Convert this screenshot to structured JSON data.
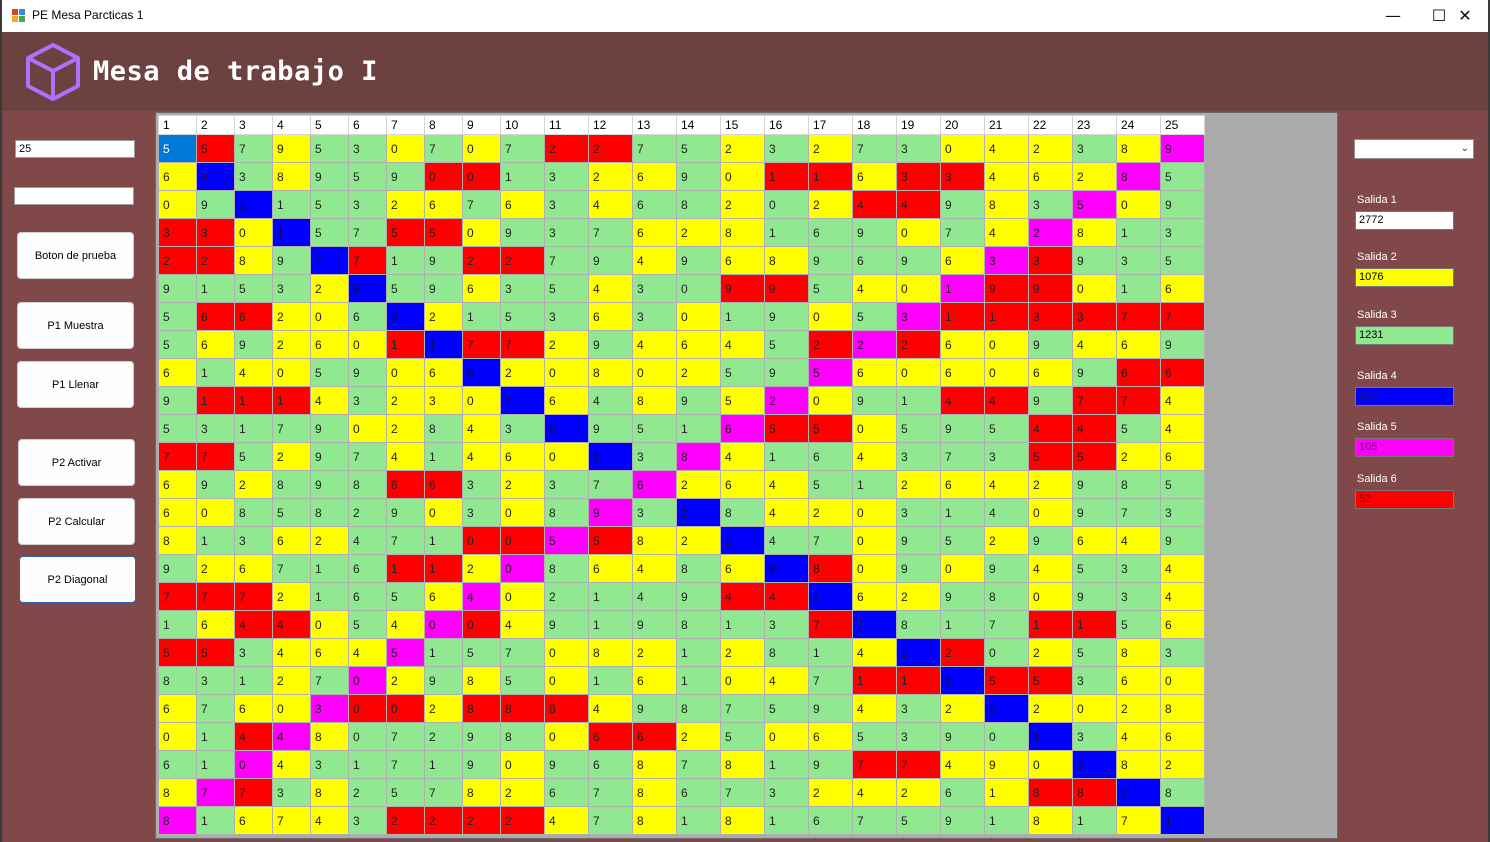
{
  "window": {
    "title": "PE Mesa Parcticas 1",
    "minimize": "—",
    "maximize": "☐",
    "close": "✕"
  },
  "header": {
    "title": "Mesa de trabajo I",
    "logo_icon": "cube-icon"
  },
  "left_panel": {
    "size_input": "25",
    "second_input": "",
    "buttons": {
      "test": "Boton de prueba",
      "p1_show": "P1 Muestra",
      "p1_fill": "P1 Llenar",
      "p2_activate": "P2 Activar",
      "p2_calc": "P2 Calcular",
      "p2_diag": "P2 Diagonal"
    }
  },
  "colors": {
    "G": "#90e890",
    "Y": "#ffff00",
    "R": "#ff0000",
    "B": "#0000ff",
    "M": "#ff00ff",
    "S": "#0078d7"
  },
  "grid": {
    "headers": [
      "1",
      "2",
      "3",
      "4",
      "5",
      "6",
      "7",
      "8",
      "9",
      "10",
      "11",
      "12",
      "13",
      "14",
      "15",
      "16",
      "17",
      "18",
      "19",
      "20",
      "21",
      "22",
      "23",
      "24",
      "25"
    ],
    "rows": [
      "5 5 7 9 5 3 0 7 0 7 2 2 7 5 2 3 2 7 3 0 4 2 3 8 9",
      "6 0 3 8 9 5 9 0 0 1 3 2 6 9 0 1 1 6 3 3 4 6 2 8 5",
      "0 9 2 1 5 3 2 6 7 6 3 4 6 8 2 0 2 4 4 9 8 3 5 0 9",
      "3 3 0 1 5 7 5 5 0 9 3 7 6 2 8 1 6 9 0 7 4 2 8 1 3",
      "2 2 8 9 7 7 1 9 2 2 7 9 4 9 6 8 9 6 9 6 3 3 9 3 5",
      "9 1 5 3 2 8 5 9 6 3 5 4 3 0 9 9 5 4 0 1 9 9 0 1 6",
      "5 6 6 2 0 6 9 2 1 5 3 6 3 0 1 9 0 5 3 1 1 3 3 7 7",
      "5 6 9 2 6 0 1 1 7 7 2 9 4 6 4 5 2 2 2 6 0 9 4 6 9",
      "6 1 4 0 5 9 0 6 6 2 0 8 0 2 5 9 5 6 0 6 0 6 9 6 6",
      "9 1 1 1 4 3 2 3 0 7 6 4 8 9 5 2 0 9 1 4 4 9 7 7 4",
      "5 3 1 7 9 0 2 8 4 3 8 9 5 1 6 5 5 0 5 9 5 4 4 5 4",
      "7 7 5 2 9 7 4 1 4 6 0 1 3 8 4 1 6 4 3 7 3 5 5 2 6",
      "6 9 2 8 9 8 6 6 3 2 3 7 6 2 6 4 5 1 2 6 4 2 9 8 5",
      "6 0 8 5 8 2 9 0 3 0 8 9 3 2 8 4 2 0 3 1 4 0 9 7 3",
      "8 1 3 6 2 4 7 1 0 0 5 5 8 2 2 4 7 0 9 5 2 9 6 4 9",
      "9 2 6 7 1 6 1 1 2 0 8 6 4 8 6 8 8 0 9 0 9 4 5 3 4",
      "7 7 7 2 1 6 5 6 4 0 2 1 4 9 4 4 4 6 2 9 8 0 9 3 4",
      "1 6 4 4 0 5 4 0 0 4 9 1 9 8 1 3 7 7 8 1 7 1 1 5 6",
      "5 5 3 4 6 4 5 1 5 7 0 8 2 1 2 8 1 4 2 2 0 2 5 8 3",
      "8 3 1 2 7 0 2 9 8 5 0 1 6 1 0 4 7 1 1 1 5 5 3 6 0",
      "6 7 6 0 3 0 0 2 8 8 8 4 9 8 7 5 9 4 3 2 2 2 0 2 8",
      "0 1 4 4 8 0 7 2 9 8 0 6 6 2 5 0 6 5 3 9 0 3 3 4 6",
      "6 1 0 4 3 1 7 1 9 0 9 6 8 7 8 1 9 7 7 4 9 0 3 8 2",
      "8 7 7 3 8 2 5 7 8 2 6 7 8 6 7 3 2 4 2 6 1 8 8 2 8",
      "8 1 6 7 4 3 2 2 2 2 4 7 8 1 8 1 6 7 5 9 1 8 1 7 1"
    ],
    "cell_colors": [
      "SRGYGGYGYGRRGGYGYGGYYYGYM",
      "YBGYGGGRRGGYYGYRRYRRYYYMG",
      "YGBGGGYYGYGYGGYGYRRGYGMYG",
      "RRYBGGRRYGGGYYYGGGYGYMYGG",
      "RRYGBRGGRRGGYGYYGGGYMRGGG",
      "GGGGYBGGYGGYGGRRGYYMRRYGY",
      "GRRYYGBYGGGYGYGGYGMRRRRRR",
      "GYGYYYRBRRYGYYYGRMRYYGYYG",
      "YGYYGGYYBYYYYYGGMYYYYYGRR",
      "GRRRYGYYYBYGYGYMYGGRRGRRY",
      "GGGGGYYGYGBGGGMRRYGGGRRGY",
      "RRGYGGYGYYYBGMYGGYGGGRRYY",
      "YGYGGGRRGYGGMYYYGGYYYYGGG",
      "YYGGGGGYGYGMGBGYYYGGGYGGG",
      "YGGYYGGGRRMRYYBGGYGGYGYYG",
      "GYYGGGRRYMGYYGYBRYGYGYGGY",
      "RRRYGGGYMYGGGGRRBYYGGYGGY",
      "GYRRYGYMRYGGGGGGRBGGGRRGY",
      "RRGYYYMGGGYYYGYGGYBRGYGYG",
      "GGGYGMYGYGYGYGYYGRRBRRGYY",
      "YGYYMRRYRRRYGGGGGYGYBYYYY",
      "YGRMYGGGGGYRRYGYYGGGGBGYY",
      "GGMYGGGGGYGGYGYGGRRYYYBYY",
      "YMRGYGGGYYGGYGGGYYYGYRRBG",
      "MGYYYGRRRRYGYGYGGGGGGYGYB"
    ]
  },
  "right_panel": {
    "select_value": "",
    "chevron_icon": "chevron-down-icon",
    "outputs": [
      {
        "label": "Salida 1",
        "value": "2772",
        "color": "#ffffff",
        "text_color": "#000000"
      },
      {
        "label": "Salida 2",
        "value": "1076",
        "color": "#ffff00",
        "text_color": "#000000"
      },
      {
        "label": "Salida 3",
        "value": "1231",
        "color": "#90e890",
        "text_color": "#000000"
      },
      {
        "label": "Salida 4",
        "value": "103",
        "color": "#0000ff",
        "text_color": "#1a1a80"
      },
      {
        "label": "Salida 5",
        "value": "105",
        "color": "#ff00ff",
        "text_color": "#6a006a"
      },
      {
        "label": "Salida 6",
        "value": "52",
        "color": "#ff0000",
        "text_color": "#7a0000"
      }
    ]
  }
}
